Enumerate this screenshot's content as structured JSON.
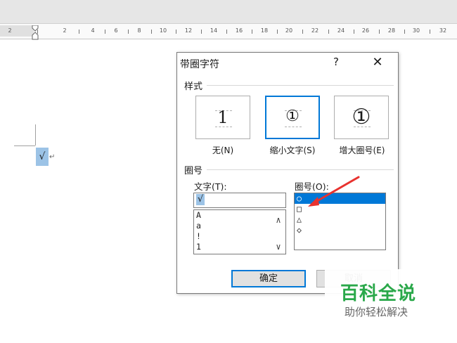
{
  "ruler": {
    "numbers": [
      "2",
      "2",
      "4",
      "6",
      "8",
      "10",
      "12",
      "14",
      "16",
      "18",
      "20",
      "22",
      "24",
      "26",
      "28",
      "30",
      "32"
    ]
  },
  "document": {
    "selected_char": "√",
    "paragraph_mark": "↵"
  },
  "dialog": {
    "title": "带圈字符",
    "help": "?",
    "close": "✕",
    "style_section": "样式",
    "styles": [
      {
        "glyph": "1",
        "caption": "无(N)"
      },
      {
        "glyph": "①",
        "caption": "缩小文字(S)"
      },
      {
        "glyph": "①",
        "caption": "增大圈号(E)"
      }
    ],
    "enclosure_section": "圈号",
    "text_label": "文字(T):",
    "text_value": "√",
    "text_list": [
      "A",
      "a",
      "!",
      "1"
    ],
    "enclosure_label": "圈号(O):",
    "enclosure_list": [
      "○",
      "□",
      "△",
      "◇"
    ],
    "ok_button": "确定",
    "cancel_button": "取消"
  },
  "watermark": {
    "title": "百科全说",
    "subtitle": "助你轻松解决"
  },
  "colors": {
    "accent": "#0078d7",
    "selection": "#9cc3e6",
    "arrow": "#e8322f",
    "watermark_green": "#2aa84a"
  }
}
